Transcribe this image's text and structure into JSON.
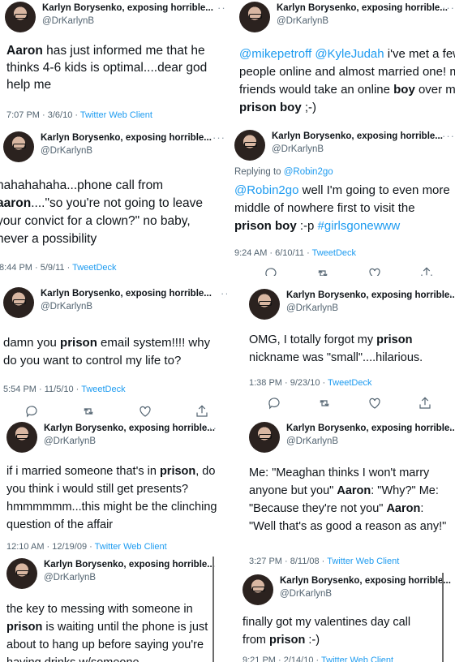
{
  "author": {
    "name": "Karlyn Borysenko, exposing horrible...",
    "handle": "@DrKarlynB",
    "more": "···"
  },
  "colors": {
    "link": "#1d9bf0",
    "muted": "#536471",
    "text": "#0f1419"
  },
  "left": [
    {
      "segments": [
        {
          "t": "Aaron",
          "b": true
        },
        {
          "t": " has just informed me that he thinks 4-6 kids is optimal....dear god help me"
        }
      ],
      "time": "7:07 PM · 3/6/10",
      "source": "Twitter Web Client"
    },
    {
      "segments": [
        {
          "t": "hahahahaha...phone call from "
        },
        {
          "t": "aaron",
          "b": true
        },
        {
          "t": "....\"so you're not going to leave your convict for a clown?\" no baby, never a possibility"
        }
      ],
      "time": "8:44 PM · 5/9/11",
      "source": "TweetDeck"
    },
    {
      "segments": [
        {
          "t": "damn you "
        },
        {
          "t": "prison",
          "b": true
        },
        {
          "t": " email system!!!! why do you want to control my life to?"
        }
      ],
      "time": "5:54 PM · 11/5/10",
      "source": "TweetDeck"
    },
    {
      "segments": [
        {
          "t": "if i married someone that's in "
        },
        {
          "t": "prison",
          "b": true
        },
        {
          "t": ", do you think i would still get presents? hmmmmmm...this might be the clinching question of the affair"
        }
      ],
      "time": "12:10 AM · 12/19/09",
      "source": "Twitter Web Client"
    },
    {
      "segments": [
        {
          "t": "the key to messing with someone in "
        },
        {
          "t": "prison",
          "b": true
        },
        {
          "t": " is waiting until the phone is just about to hang up before  saying you're having drinks w/someone"
        }
      ],
      "time": "",
      "source": ""
    }
  ],
  "right": [
    {
      "segments": [
        {
          "t": "@mikepetroff",
          "l": true
        },
        {
          "t": " "
        },
        {
          "t": "@KyleJudah",
          "l": true
        },
        {
          "t": " i've met a few people online and almost married one! my friends would take an online "
        },
        {
          "t": "boy",
          "b": true
        },
        {
          "t": " over my "
        },
        {
          "t": "prison boy",
          "b": true
        },
        {
          "t": " ;-)"
        }
      ],
      "time": "",
      "source": ""
    },
    {
      "reply_prefix": "Replying to ",
      "reply_to": "@Robin2go",
      "segments": [
        {
          "t": "@Robin2go",
          "l": true
        },
        {
          "t": " well I'm going to even more middle of nowhere first to visit the "
        },
        {
          "t": "prison boy",
          "b": true
        },
        {
          "t": " :-p "
        },
        {
          "t": "#girlsgonewww",
          "l": true
        }
      ],
      "time": "9:24 AM · 6/10/11",
      "source": "TweetDeck"
    },
    {
      "segments": [
        {
          "t": "OMG, I totally forgot my "
        },
        {
          "t": "prison",
          "b": true
        },
        {
          "t": " nickname was \"small\"....hilarious."
        }
      ],
      "time": "1:38 PM · 9/23/10",
      "source": "TweetDeck"
    },
    {
      "segments": [
        {
          "t": "Me: \"Meaghan thinks I won't marry anyone but you\" "
        },
        {
          "t": "Aaron",
          "b": true
        },
        {
          "t": ": \"Why?\" Me: \"Because they're not you\" "
        },
        {
          "t": "Aaron",
          "b": true
        },
        {
          "t": ": \"Well that's as good a reason as any!\""
        }
      ],
      "time": "3:27 PM · 8/11/08",
      "source": "Twitter Web Client"
    },
    {
      "segments": [
        {
          "t": "finally got my valentines day call from "
        },
        {
          "t": "prison",
          "b": true
        },
        {
          "t": " :-)"
        }
      ],
      "time": "9:21 PM · 2/14/10",
      "source": "Twitter Web Client"
    }
  ]
}
